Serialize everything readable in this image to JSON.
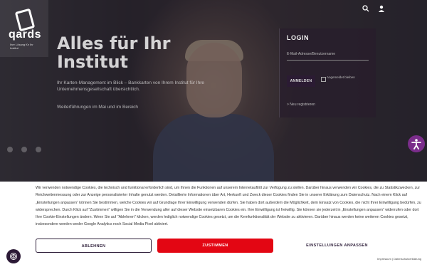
{
  "brand": {
    "name": "qards",
    "tagline": "Ihre Lösung für Ihr Institut"
  },
  "header": {
    "icons": [
      "search-icon",
      "user-icon"
    ]
  },
  "hero": {
    "title_line1": "Alles für Ihr",
    "title_line2": "Institut",
    "lead": "Ihr Karten-Management im Blick – Bankkarten von Ihrem Institut für Ihre Unternehmensgesellschaft übersichtlich.",
    "lead2": "Weiterführungen im Mai und im Bereich"
  },
  "login": {
    "heading": "LOGIN",
    "username_placeholder": "E-Mail-Adresse/Benutzername",
    "submit_label": "ANMELDEN",
    "remember_label": "Angemeldet bleiben",
    "forgot_label": "> Neu registrieren"
  },
  "cookie_banner": {
    "text": "Wir verwenden notwendige Cookies, die technisch und funktional erforderlich sind, um Ihnen die Funktionen auf unserem Internetauftritt zur Verfügung zu stellen. Darüber hinaus verwenden wir Cookies, die zu Statistikzwecken, zur Reichweitenmessung oder zur Anzeige personalisierter Inhalte genutzt werden. Detaillierte Informationen über Art, Herkunft und Zweck dieser Cookies finden Sie in unserer Erklärung zum Datenschutz. Nach einem Klick auf „Einstellungen anpassen“ können Sie bestimmen, welche Cookies wir auf Grundlage Ihrer Einwilligung verwenden dürfen. Sie haben dort außerdem die Möglichkeit, dem Einsatz von Cookies, die nicht Ihrer Einwilligung bedürfen, zu widersprechen. Durch Klick auf \"Zustimmen\" willigen Sie in die Verwendung aller auf dieser Website einsetzbaren Cookies ein. Ihre Einwilligung ist freiwillig. Sie können sie jederzeit in „Einstellungen anpassen“ widerrufen oder dort Ihre Cookie-Einstellungen ändern. Wenn Sie auf \"Ablehnen\" klicken, werden lediglich notwendige Cookies gesetzt, um die Kernfunktionalität der Website zu aktivieren. Darüber hinaus werden keine weiteren Cookies gesetzt, insbesondere werden weder Google Analytics noch Social Media Pixel aktiviert.",
    "decline_label": "ABLEHNEN",
    "accept_label": "ZUSTIMMEN",
    "settings_label": "EINSTELLUNGEN ANPASSEN",
    "footer_links": "Impressum | Datenschutzerklärung"
  },
  "colors": {
    "accent": "#e30613",
    "brand_dark": "#2e1f3a",
    "accessibility": "#7b2d8b"
  }
}
